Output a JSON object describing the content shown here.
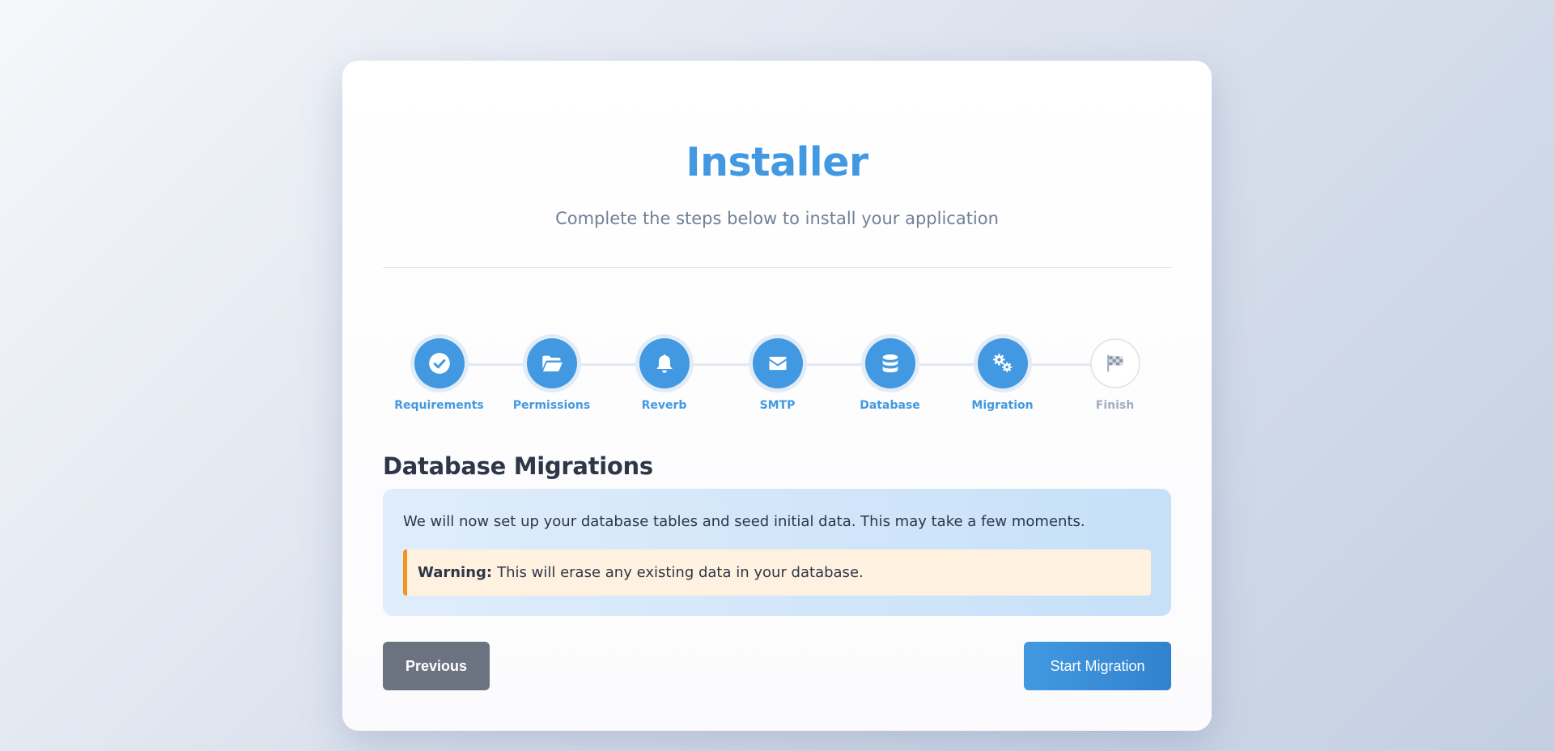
{
  "header": {
    "title": "Installer",
    "subtitle": "Complete the steps below to install your application"
  },
  "steps": [
    {
      "label": "Requirements",
      "icon": "check-circle-icon",
      "state": "completed"
    },
    {
      "label": "Permissions",
      "icon": "folder-open-icon",
      "state": "completed"
    },
    {
      "label": "Reverb",
      "icon": "bell-icon",
      "state": "completed"
    },
    {
      "label": "SMTP",
      "icon": "envelope-icon",
      "state": "completed"
    },
    {
      "label": "Database",
      "icon": "database-icon",
      "state": "completed"
    },
    {
      "label": "Migration",
      "icon": "cogs-icon",
      "state": "active"
    },
    {
      "label": "Finish",
      "icon": "flag-checkered-icon",
      "state": "pending"
    }
  ],
  "section": {
    "title": "Database Migrations",
    "info_text": "We will now set up your database tables and seed initial data. This may take a few moments.",
    "warning_label": "Warning:",
    "warning_text": "This will erase any existing data in your database."
  },
  "buttons": {
    "previous": "Previous",
    "start": "Start Migration"
  },
  "colors": {
    "accent": "#4299e1",
    "inactive": "#a0aec0",
    "warning": "#f6921e",
    "secondary_button": "#6b7280"
  }
}
